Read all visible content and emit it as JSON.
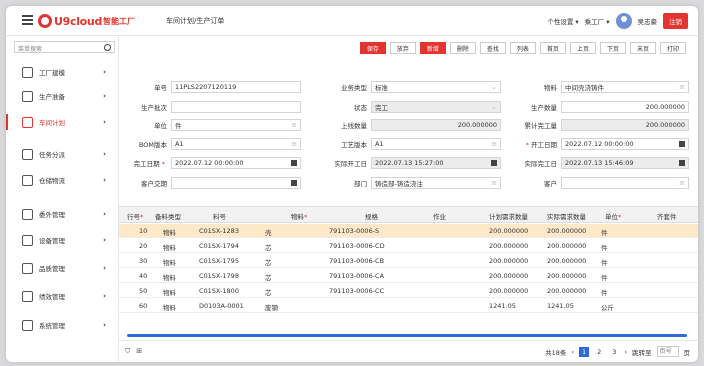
{
  "header": {
    "logo_text": "U9cloud",
    "logo_sub": "智能工厂",
    "breadcrumb": "车间计划/生产订单",
    "personal_settings": "个性设置",
    "factory": "乘工厂",
    "user": "吴志豪",
    "logout": "注销"
  },
  "sidebar": {
    "search_placeholder": "菜单搜索",
    "items": [
      {
        "label": "工厂建模"
      },
      {
        "label": "生产准备"
      },
      {
        "label": "车间计划"
      },
      {
        "label": "任务分派"
      },
      {
        "label": "仓储物流"
      },
      {
        "label": "委外管理"
      },
      {
        "label": "设备管理"
      },
      {
        "label": "品质管理"
      },
      {
        "label": "绩效管理"
      },
      {
        "label": "系统管理"
      }
    ]
  },
  "toolbar": [
    "保存",
    "放弃",
    "新增",
    "删除",
    "查找",
    "列表",
    "首页",
    "上页",
    "下页",
    "末页",
    "打印"
  ],
  "form": {
    "order_no_label": "单号",
    "order_no": "11PLS2207120119",
    "biz_type_label": "业务类型",
    "biz_type": "标准",
    "material_label": "物料",
    "material": "中间壳浇铸件",
    "batch_label": "生产批次",
    "batch": "",
    "status_label": "状态",
    "status": "完工",
    "qty_label": "生产数量",
    "qty": "200.000000",
    "unit_label": "单位",
    "unit": "件",
    "online_qty_label": "上线数量",
    "online_qty": "200.000000",
    "done_qty_label": "累计完工量",
    "done_qty": "200.000000",
    "bom_label": "BOM版本",
    "bom": "A1",
    "route_label": "工艺版本",
    "route": "A1",
    "start_date_label": "开工日期",
    "start_date": "2022.07.12 00:00:00",
    "finish_date_label": "完工日期",
    "finish_date": "2022.07.12 00:00:00",
    "act_start_label": "实际开工日",
    "act_start": "2022.07.13 15:27:00",
    "act_finish_label": "实际完工日",
    "act_finish": "2022.07.13 15:46:09",
    "cust_date_label": "客户交期",
    "cust_date": "",
    "dept_label": "部门",
    "dept": "铸造部-铸造浇注",
    "customer_label": "客户",
    "customer": ""
  },
  "table": {
    "headers": [
      "行号",
      "备料类型",
      "料号",
      "物料",
      "规格",
      "作业",
      "计划需求数量",
      "实际需求数量",
      "单位",
      "齐套件"
    ],
    "rows": [
      {
        "line": "10",
        "type": "物料",
        "code": "C01SX-1283",
        "name": "壳",
        "spec": "791103-0006-S",
        "job": "",
        "plan": "200.000000",
        "actual": "200.000000",
        "unit": "件"
      },
      {
        "line": "20",
        "type": "物料",
        "code": "C01SX-1794",
        "name": "芯",
        "spec": "791103-0006-CD",
        "job": "",
        "plan": "200.000000",
        "actual": "200.000000",
        "unit": "件"
      },
      {
        "line": "30",
        "type": "物料",
        "code": "C01SX-1795",
        "name": "芯",
        "spec": "791103-0006-CB",
        "job": "",
        "plan": "200.000000",
        "actual": "200.000000",
        "unit": "件"
      },
      {
        "line": "40",
        "type": "物料",
        "code": "C01SX-1798",
        "name": "芯",
        "spec": "791103-0006-CA",
        "job": "",
        "plan": "200.000000",
        "actual": "200.000000",
        "unit": "件"
      },
      {
        "line": "50",
        "type": "物料",
        "code": "C01SX-1800",
        "name": "芯",
        "spec": "791103-0006-CC",
        "job": "",
        "plan": "200.000000",
        "actual": "200.000000",
        "unit": "件"
      },
      {
        "line": "60",
        "type": "物料",
        "code": "D0103A-0001",
        "name": "废钢",
        "spec": "",
        "job": "",
        "plan": "1241.05",
        "actual": "1241.05",
        "unit": "公斤"
      }
    ]
  },
  "footer": {
    "total": "共18条",
    "pages": [
      "1",
      "2",
      "3"
    ],
    "goto_label": "跳转至",
    "goto_placeholder": "页号",
    "page_suffix": "页"
  }
}
